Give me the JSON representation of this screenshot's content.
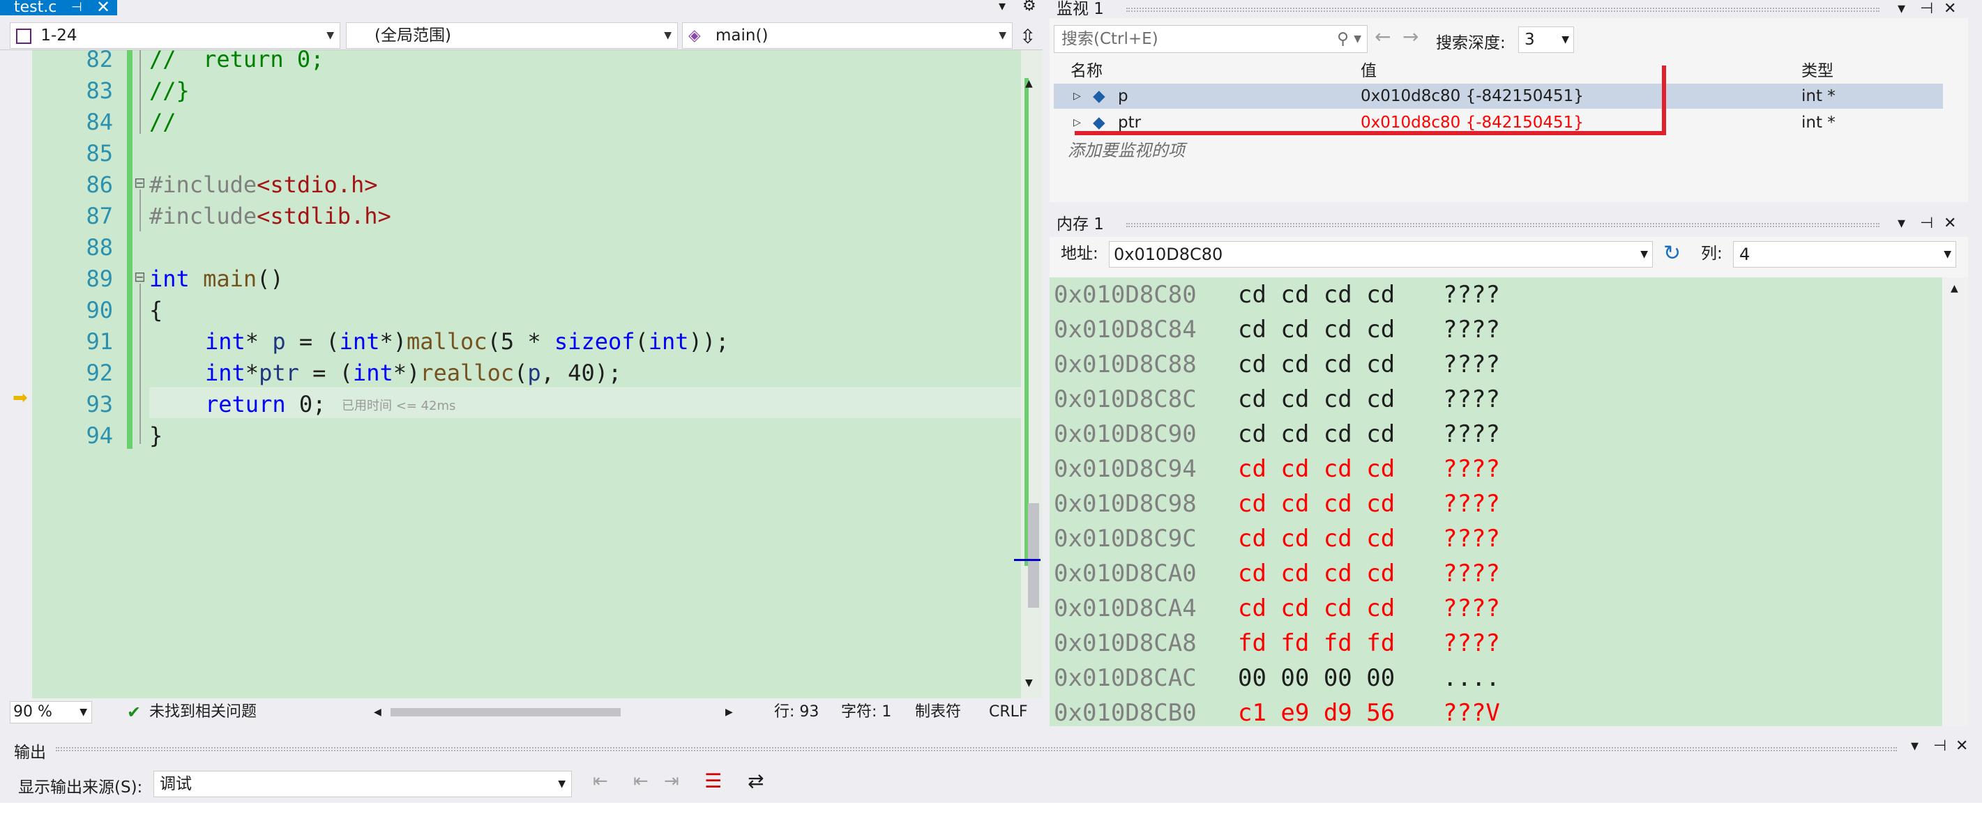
{
  "editor_tab": {
    "file": "test.c",
    "pin": "⊣",
    "close": "✕"
  },
  "navbar": {
    "scope": "1-24",
    "range": "(全局范围)",
    "function": "main()"
  },
  "code_lines": [
    {
      "n": "82",
      "text": "//  return 0;"
    },
    {
      "n": "83",
      "text": "//}"
    },
    {
      "n": "84",
      "text": "//"
    },
    {
      "n": "85",
      "text": ""
    },
    {
      "n": "86",
      "text": "#include<stdio.h>"
    },
    {
      "n": "87",
      "text": "#include<stdlib.h>"
    },
    {
      "n": "88",
      "text": ""
    },
    {
      "n": "89",
      "text": "int main()"
    },
    {
      "n": "90",
      "text": "{"
    },
    {
      "n": "91",
      "text": "int* p = (int*)malloc(5 * sizeof(int));"
    },
    {
      "n": "92",
      "text": "int*ptr = (int*)realloc(p, 40);"
    },
    {
      "n": "93",
      "text": "return 0;"
    },
    {
      "n": "94",
      "text": "}"
    }
  ],
  "perf_tip": "已用时间 <= 42ms",
  "status": {
    "zoom": "90 %",
    "issues": "未找到相关问题",
    "line": "行: 93",
    "col": "字符: 1",
    "tab": "制表符",
    "eol": "CRLF"
  },
  "watch": {
    "title": "监视 1",
    "search_placeholder": "搜索(Ctrl+E)",
    "depth_label": "搜索深度:",
    "depth": "3",
    "col_name": "名称",
    "col_value": "值",
    "col_type": "类型",
    "rows": [
      {
        "name": "p",
        "value": "0x010d8c80 {-842150451}",
        "type": "int *"
      },
      {
        "name": "ptr",
        "value": "0x010d8c80 {-842150451}",
        "type": "int *"
      }
    ],
    "add_item": "添加要监视的项"
  },
  "memory": {
    "title": "内存 1",
    "addr_label": "地址:",
    "address": "0x010D8C80",
    "cols_label": "列:",
    "cols": "4",
    "rows": [
      {
        "addr": "0x010D8C80",
        "bytes": "cd cd cd cd",
        "ascii": "????",
        "changed": false
      },
      {
        "addr": "0x010D8C84",
        "bytes": "cd cd cd cd",
        "ascii": "????",
        "changed": false
      },
      {
        "addr": "0x010D8C88",
        "bytes": "cd cd cd cd",
        "ascii": "????",
        "changed": false
      },
      {
        "addr": "0x010D8C8C",
        "bytes": "cd cd cd cd",
        "ascii": "????",
        "changed": false
      },
      {
        "addr": "0x010D8C90",
        "bytes": "cd cd cd cd",
        "ascii": "????",
        "changed": false
      },
      {
        "addr": "0x010D8C94",
        "bytes": "cd cd cd cd",
        "ascii": "????",
        "changed": true
      },
      {
        "addr": "0x010D8C98",
        "bytes": "cd cd cd cd",
        "ascii": "????",
        "changed": true
      },
      {
        "addr": "0x010D8C9C",
        "bytes": "cd cd cd cd",
        "ascii": "????",
        "changed": true
      },
      {
        "addr": "0x010D8CA0",
        "bytes": "cd cd cd cd",
        "ascii": "????",
        "changed": true
      },
      {
        "addr": "0x010D8CA4",
        "bytes": "cd cd cd cd",
        "ascii": "????",
        "changed": true
      },
      {
        "addr": "0x010D8CA8",
        "bytes": "fd fd fd fd",
        "ascii": "????",
        "changed": true
      },
      {
        "addr": "0x010D8CAC",
        "bytes": "00 00 00 00",
        "ascii": "....",
        "changed": false
      },
      {
        "addr": "0x010D8CB0",
        "bytes": "c1 e9 d9 56",
        "ascii": "???V",
        "changed": true
      }
    ]
  },
  "output": {
    "title": "输出",
    "source_label": "显示输出来源(S):",
    "source": "调试"
  },
  "colors": {
    "accent": "#007acc",
    "editor_bg": "#cce8cf",
    "changed": "#ff0000",
    "annotation": "#e0202a"
  }
}
